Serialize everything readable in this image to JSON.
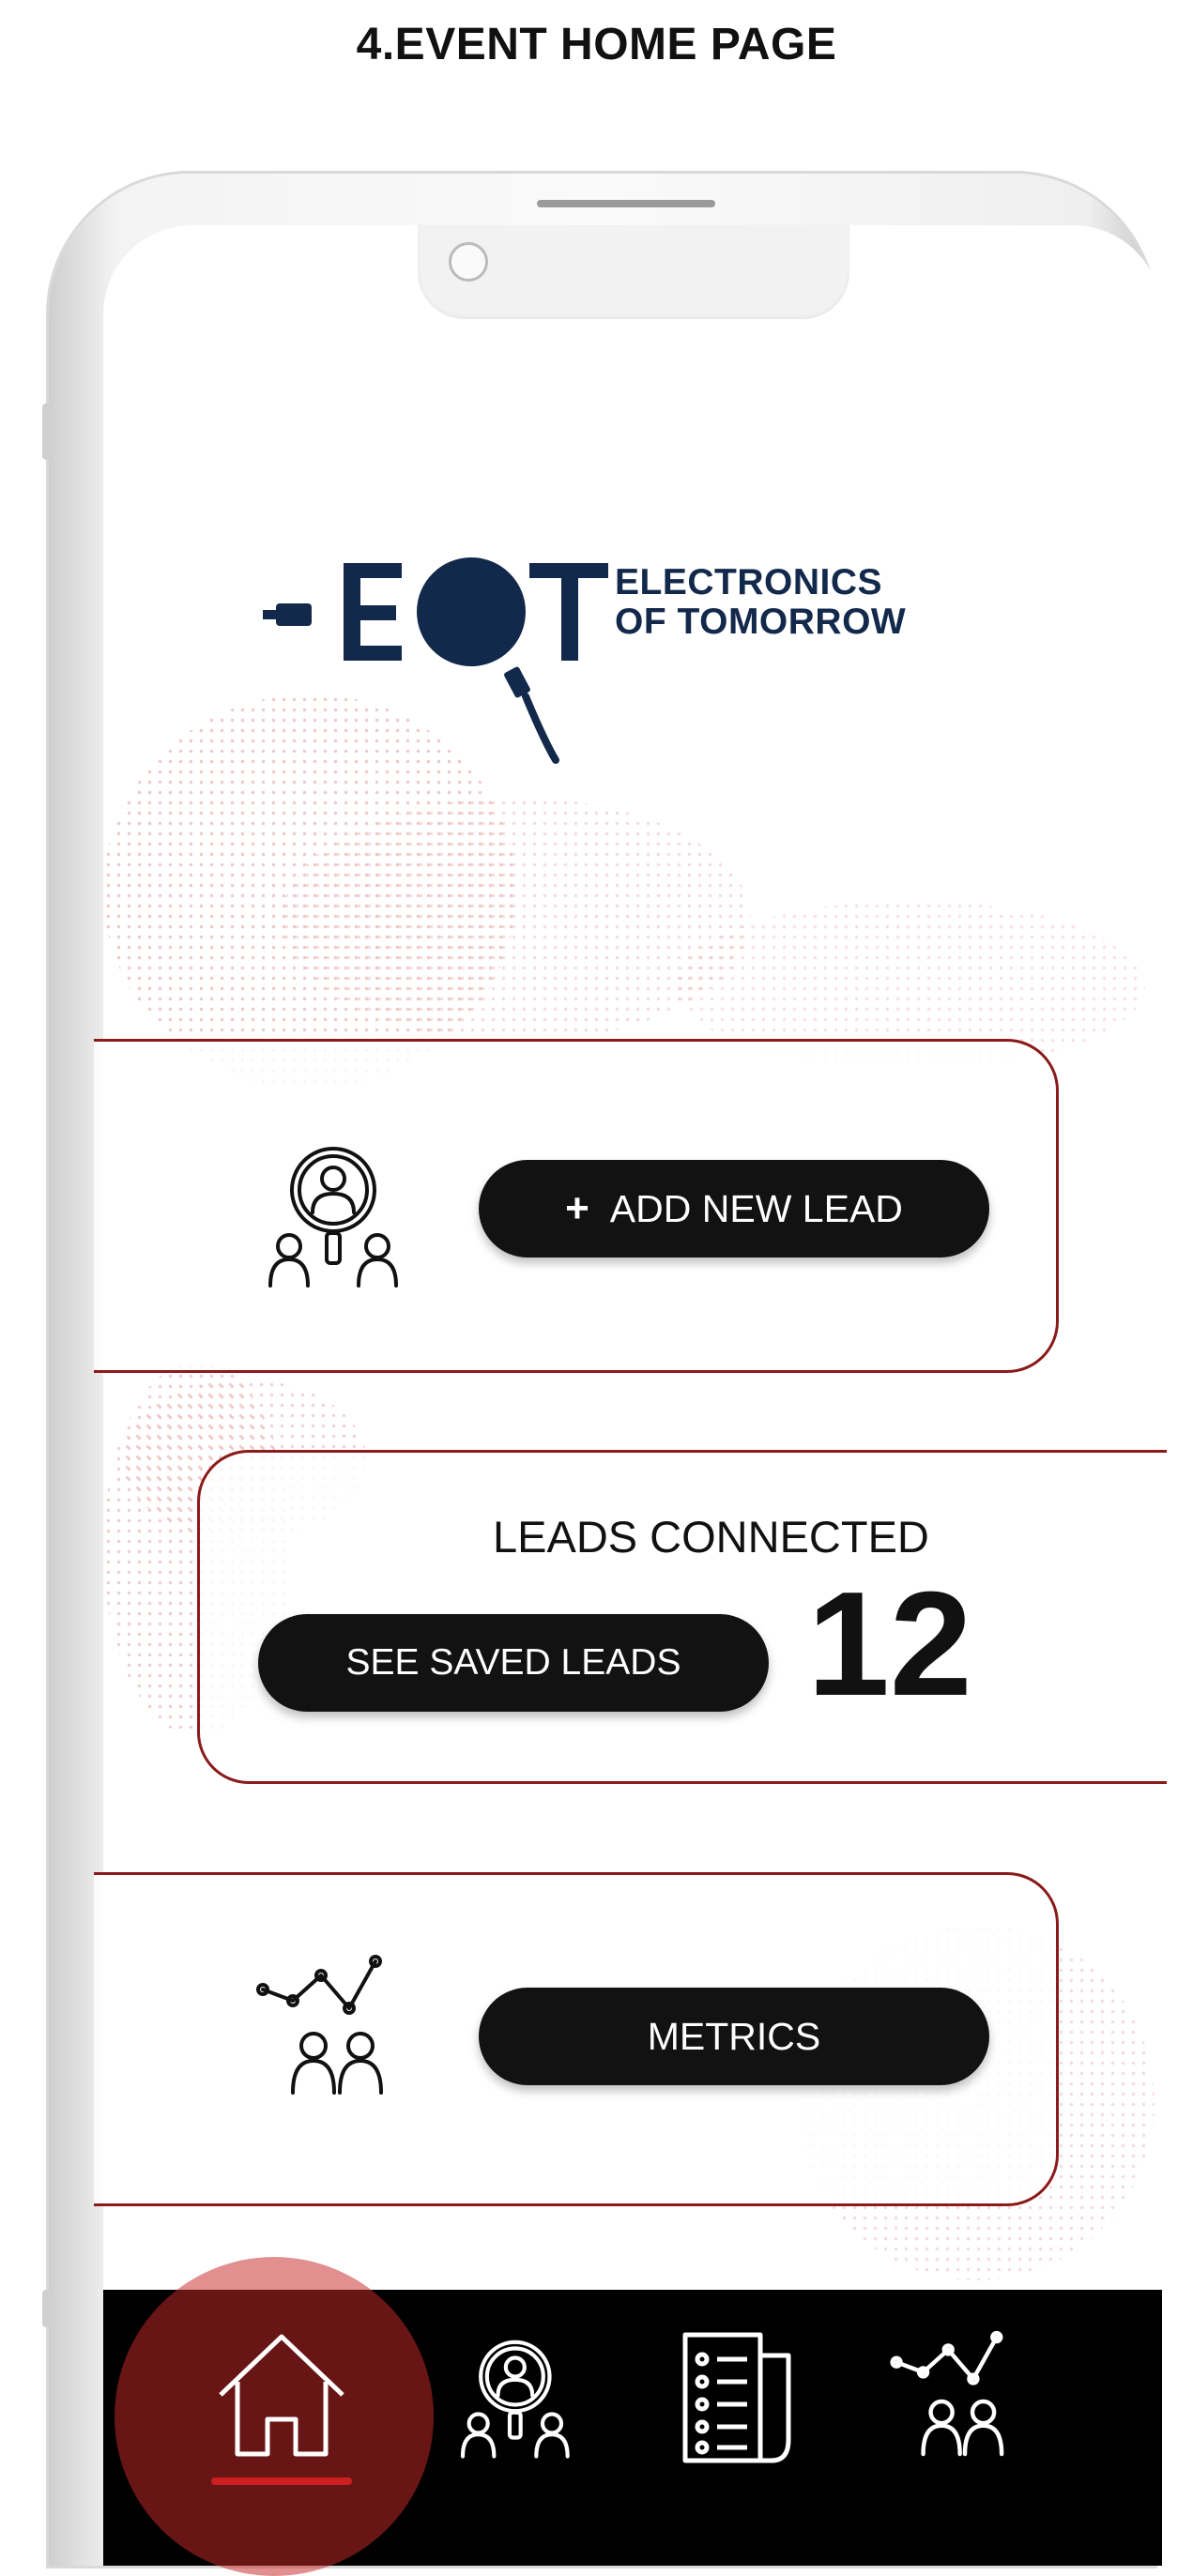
{
  "page": {
    "title": "4.EVENT HOME PAGE"
  },
  "logo": {
    "letters": "EOT",
    "line1": "ELECTRONICS",
    "line2": "OF TOMORROW",
    "color": "#13294b"
  },
  "cards": {
    "add_lead": {
      "button_label": "ADD NEW LEAD",
      "icon": "lead-search-icon"
    },
    "leads": {
      "label": "LEADS CONNECTED",
      "count": "12",
      "button_label": "SEE SAVED LEADS"
    },
    "metrics": {
      "button_label": "METRICS",
      "icon": "metrics-people-icon"
    }
  },
  "nav": {
    "items": [
      {
        "icon": "home-icon",
        "active": true
      },
      {
        "icon": "lead-search-icon",
        "active": false
      },
      {
        "icon": "list-document-icon",
        "active": false
      },
      {
        "icon": "metrics-people-icon",
        "active": false
      }
    ]
  },
  "colors": {
    "accent": "#cc1f1f",
    "card_border": "#8b1a1a",
    "pill": "#121212",
    "nav": "#000000"
  }
}
